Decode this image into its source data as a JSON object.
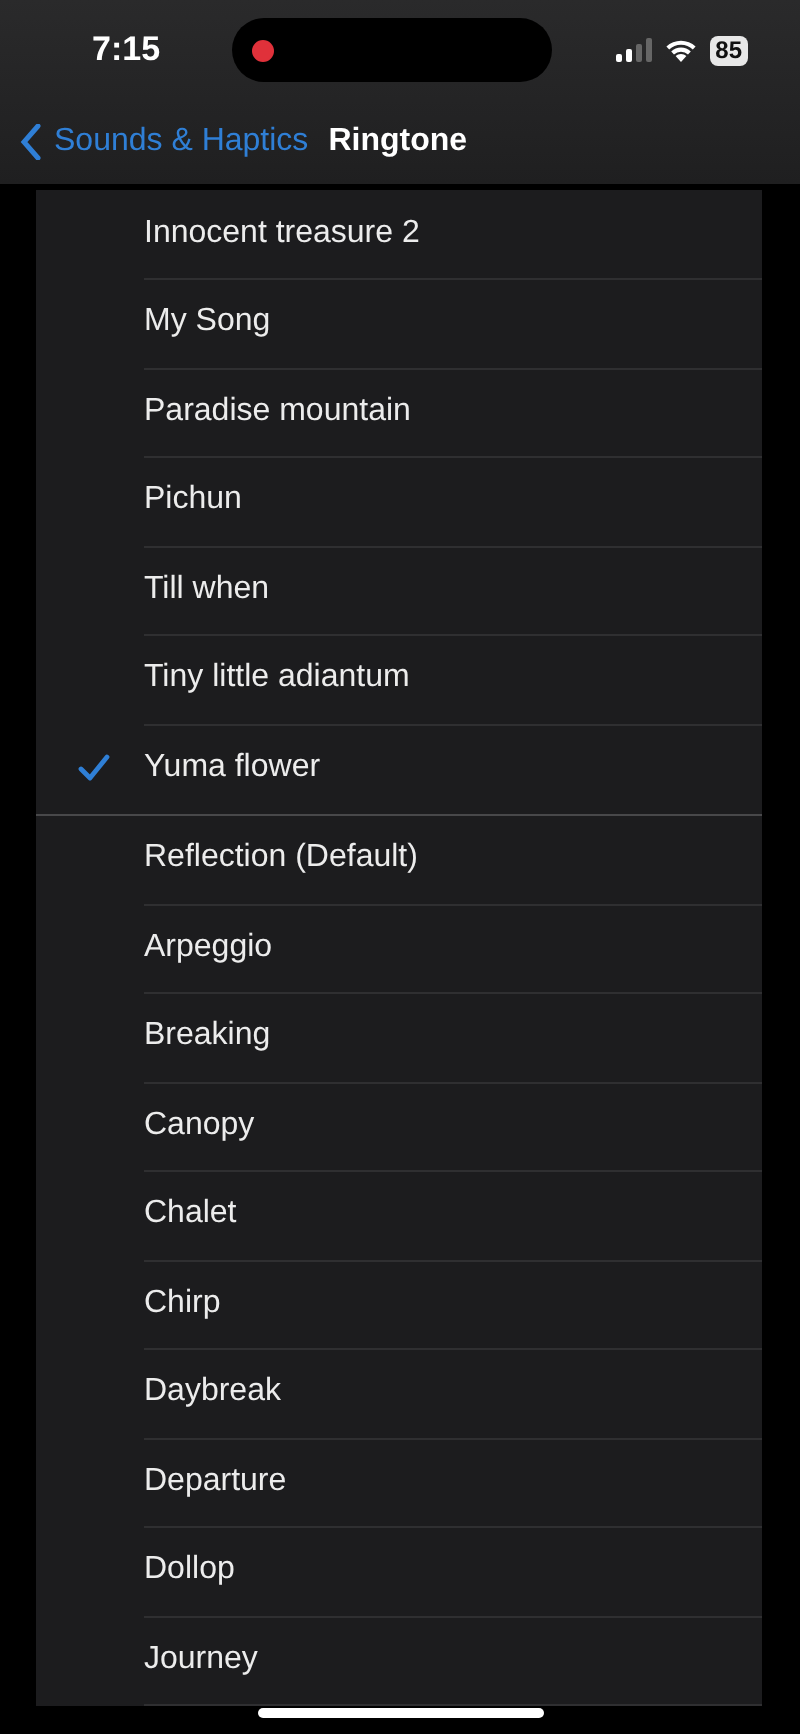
{
  "status_bar": {
    "time": "7:15",
    "recording": true,
    "battery": "85"
  },
  "nav": {
    "back": "Sounds & Haptics",
    "title": "Ringtone"
  },
  "groups": [
    {
      "rows": [
        {
          "label": "Innocent treasure 2",
          "selected": false
        },
        {
          "label": "My Song",
          "selected": false
        },
        {
          "label": "Paradise mountain",
          "selected": false
        },
        {
          "label": "Pichun",
          "selected": false
        },
        {
          "label": "Till when",
          "selected": false
        },
        {
          "label": "Tiny little adiantum",
          "selected": false
        },
        {
          "label": "Yuma flower",
          "selected": true
        }
      ]
    },
    {
      "rows": [
        {
          "label": "Reflection (Default)",
          "selected": false
        },
        {
          "label": "Arpeggio",
          "selected": false
        },
        {
          "label": "Breaking",
          "selected": false
        },
        {
          "label": "Canopy",
          "selected": false
        },
        {
          "label": "Chalet",
          "selected": false
        },
        {
          "label": "Chirp",
          "selected": false
        },
        {
          "label": "Daybreak",
          "selected": false
        },
        {
          "label": "Departure",
          "selected": false
        },
        {
          "label": "Dollop",
          "selected": false
        },
        {
          "label": "Journey",
          "selected": false
        }
      ]
    }
  ]
}
